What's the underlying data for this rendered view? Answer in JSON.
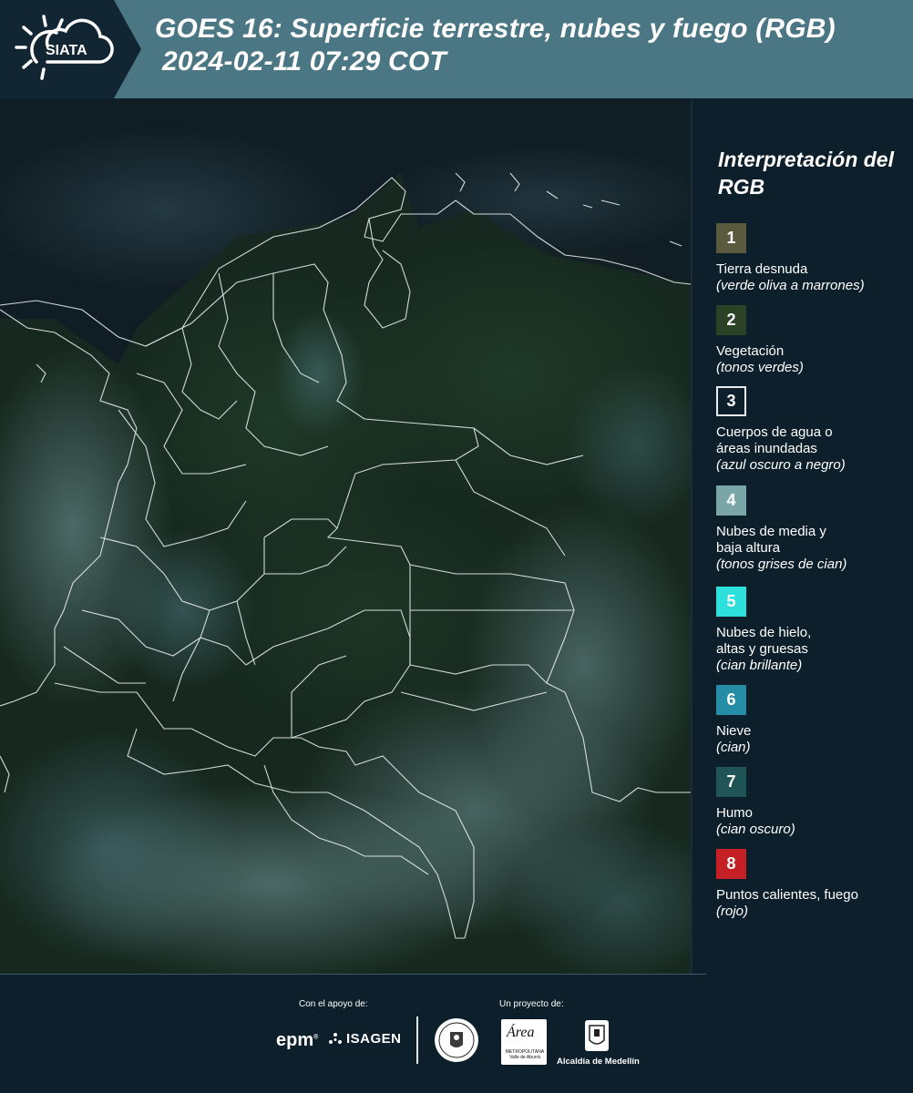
{
  "header": {
    "logo_text": "SIATA",
    "title_line1": "GOES 16: Superficie terrestre, nubes y fuego (RGB)",
    "title_line2": "2024-02-11 07:29 COT"
  },
  "legend": {
    "title": "Interpretación del RGB",
    "items": [
      {
        "num": "1",
        "name": "Tierra desnuda",
        "desc": "(verde oliva a marrones)",
        "color": "#5a5a3e"
      },
      {
        "num": "2",
        "name": "Vegetación",
        "desc": "(tonos verdes)",
        "color": "#2b4226"
      },
      {
        "num": "3",
        "name": "Cuerpos de agua o áreas inundadas",
        "desc": "(azul oscuro a negro)",
        "color": "#0c1f2a"
      },
      {
        "num": "4",
        "name": "Nubes de media y baja altura",
        "desc": "(tonos grises de cian)",
        "color": "#7aa6a8"
      },
      {
        "num": "5",
        "name": "Nubes de hielo, altas y gruesas",
        "desc": "(cian brillante)",
        "color": "#2de0dc"
      },
      {
        "num": "6",
        "name": "Nieve",
        "desc": "(cian)",
        "color": "#258ea6"
      },
      {
        "num": "7",
        "name": "Humo",
        "desc": "(cian oscuro)",
        "color": "#1f5556"
      },
      {
        "num": "8",
        "name": "Puntos calientes, fuego",
        "desc": "(rojo)",
        "color": "#c42026"
      }
    ]
  },
  "footer": {
    "support_label": "Con el apoyo de:",
    "project_label": "Un proyecto de:",
    "sponsor1": "epm",
    "sponsor2": "ISAGEN",
    "partner_area": "Área",
    "partner_area_sub": "METROPOLITANA Valle de Aburrá",
    "partner_medellin": "Alcaldía de Medellín"
  }
}
